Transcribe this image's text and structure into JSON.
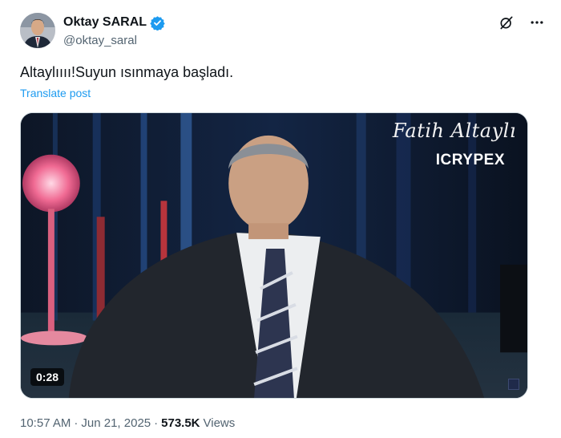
{
  "author": {
    "display_name": "Oktay SARAL",
    "handle": "@oktay_saral",
    "verified": true,
    "verified_color": "#1d9bf0",
    "avatar_icon": "profile-avatar"
  },
  "tweet": {
    "text": "Altaylıııı!Suyun ısınmaya başladı.",
    "translate_label": "Translate post"
  },
  "media": {
    "type": "video",
    "duration": "0:28",
    "watermark_name": "Fatih Altaylı",
    "watermark_brand": "ICRYPEX"
  },
  "meta": {
    "time": "10:57 AM",
    "separator": "·",
    "date": "Jun 21, 2025",
    "views_count": "573.5K",
    "views_label": "Views"
  },
  "icons": {
    "grok": "grok-icon",
    "more": "more-options-icon"
  },
  "colors": {
    "text_primary": "#0f1419",
    "text_secondary": "#536471",
    "link": "#1d9bf0"
  }
}
